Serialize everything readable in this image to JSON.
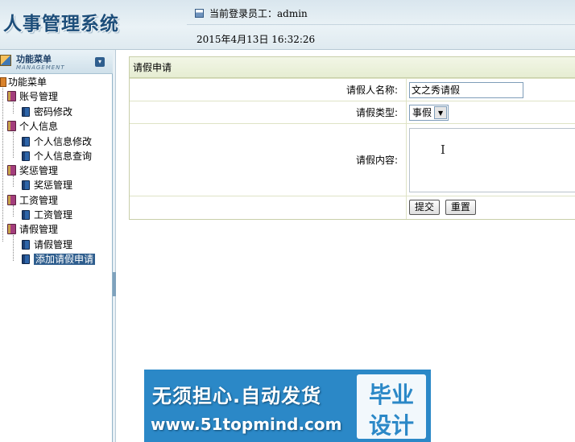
{
  "header": {
    "app_title": "人事管理系统",
    "current_user": "当前登录员工：admin",
    "datetime": "2015年4月13日  16:32:26"
  },
  "sidebar": {
    "title": "功能菜单",
    "subtitle": "MANAGEMENT",
    "root": "功能菜单",
    "groups": [
      {
        "label": "账号管理",
        "items": [
          "密码修改"
        ]
      },
      {
        "label": "个人信息",
        "items": [
          "个人信息修改",
          "个人信息查询"
        ]
      },
      {
        "label": "奖惩管理",
        "items": [
          "奖惩管理"
        ]
      },
      {
        "label": "工资管理",
        "items": [
          "工资管理"
        ]
      },
      {
        "label": "请假管理",
        "items": [
          "请假管理",
          "添加请假申请"
        ]
      }
    ],
    "selected_item": "添加请假申请"
  },
  "form": {
    "title": "请假申请",
    "name_label": "请假人名称:",
    "name_value": "文之秀请假",
    "type_label": "请假类型:",
    "type_value": "事假",
    "content_label": "请假内容:",
    "content_value": "",
    "submit_label": "提交",
    "reset_label": "重置"
  },
  "ad": {
    "slogan": "无须担心.自动发货",
    "url": "www.51topmind.com",
    "badge_line1": "毕业",
    "badge_line2": "设计"
  },
  "colors": {
    "header_title": "#1d4e7a",
    "selected_bg": "#2f5e8e",
    "ad_bg": "#2b88c7"
  }
}
